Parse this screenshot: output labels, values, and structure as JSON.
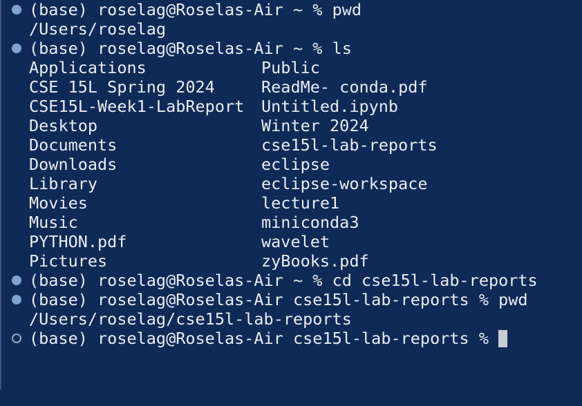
{
  "terminal": {
    "prompt1": "(base) roselag@Roselas-Air ~ % pwd",
    "output_pwd1": "/Users/roselag",
    "prompt2": "(base) roselag@Roselas-Air ~ % ls",
    "listing": [
      [
        "Applications",
        "Public"
      ],
      [
        "CSE 15L Spring 2024",
        "ReadMe- conda.pdf"
      ],
      [
        "CSE15L-Week1-LabReport",
        "Untitled.ipynb"
      ],
      [
        "Desktop",
        "Winter 2024"
      ],
      [
        "Documents",
        "cse15l-lab-reports"
      ],
      [
        "Downloads",
        "eclipse"
      ],
      [
        "Library",
        "eclipse-workspace"
      ],
      [
        "Movies",
        "lecture1"
      ],
      [
        "Music",
        "miniconda3"
      ],
      [
        "PYTHON.pdf",
        "wavelet"
      ],
      [
        "Pictures",
        "zyBooks.pdf"
      ]
    ],
    "prompt3": "(base) roselag@Roselas-Air ~ % cd cse15l-lab-reports",
    "prompt4": "(base) roselag@Roselas-Air cse15l-lab-reports % pwd",
    "output_pwd2": "/Users/roselag/cse15l-lab-reports",
    "prompt5": "(base) roselag@Roselas-Air cse15l-lab-reports %",
    "colors": {
      "background": "#0f2a56",
      "text": "#e9edf5",
      "decoration_done": "#7fa4cf",
      "decoration_pending": "#98a7bd",
      "cursor": "#c8ccd3"
    }
  }
}
